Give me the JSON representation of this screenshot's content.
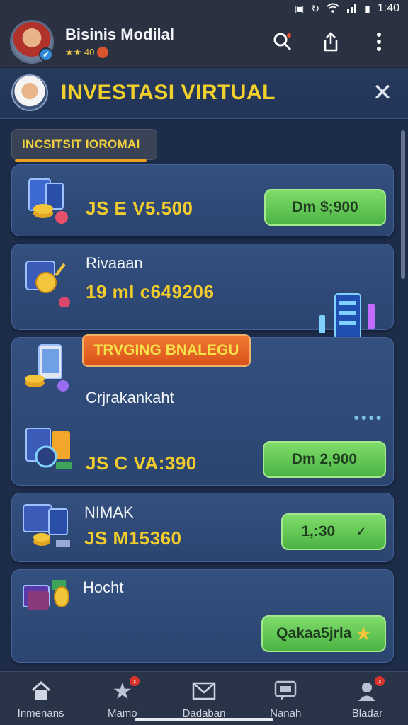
{
  "status_bar": {
    "time": "1:40",
    "battery": "▮"
  },
  "header": {
    "title": "Bisinis Modilal",
    "subtitle": "★★ 40",
    "icons": [
      "search-icon",
      "share-icon",
      "more-vert-icon"
    ]
  },
  "modal": {
    "title": "INVESTASI VIRTUAL",
    "close": "✕"
  },
  "section": {
    "label": "INCSITSIT IOROMAI"
  },
  "cards": [
    {
      "amount": "JS E V5.500",
      "button": "Dm $;900"
    },
    {
      "label": "Rivaaan",
      "amount": "19 ml c649206"
    },
    {
      "badge": "TRVGING BNALEGU",
      "label": "Crjrakankaht",
      "dots": "●●●●",
      "amount": "JS C VA:390",
      "button": "Dm 2,900"
    },
    {
      "label": "NIMAK",
      "amount": "JS M15360",
      "button": "1,:30"
    },
    {
      "label": "Hocht",
      "button": "Qakaa5jrla"
    }
  ],
  "nav": [
    {
      "label": "Inmenans",
      "icon": "home-icon"
    },
    {
      "label": "Mamo",
      "icon": "star-icon",
      "badge": "x"
    },
    {
      "label": "Dadaban",
      "icon": "mail-icon"
    },
    {
      "label": "Nanah",
      "icon": "chat-icon"
    },
    {
      "label": "Bladar",
      "icon": "user-icon",
      "badge": "x"
    }
  ],
  "colors": {
    "accent_yellow": "#f1cf2c",
    "button_green": "#4bb444",
    "badge_orange": "#d9521c"
  }
}
